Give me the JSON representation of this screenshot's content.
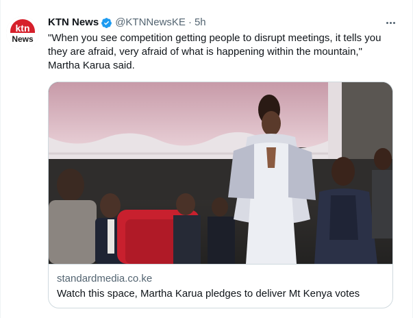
{
  "tweet": {
    "avatar_logo_text_top": "ktn",
    "avatar_logo_text_bottom": "News",
    "display_name": "KTN News",
    "handle": "@KTNNewsKE",
    "separator": "·",
    "time": "5h",
    "text_lines": [
      "\"When you see competition getting people to disrupt meetings, it tells you",
      "they are afraid, very afraid of what is happening within the mountain,\"",
      "Martha Karua said."
    ],
    "card": {
      "domain": "standardmedia.co.ke",
      "title": "Watch this space, Martha Karua pledges to deliver Mt Kenya votes"
    }
  },
  "colors": {
    "verified_blue": "#1d9bf0",
    "secondary_text": "#536471",
    "brand_red": "#c8102e",
    "card_border": "#cfd9de"
  },
  "icons": {
    "verified": "verified-badge-icon",
    "more": "more-dots-icon"
  }
}
